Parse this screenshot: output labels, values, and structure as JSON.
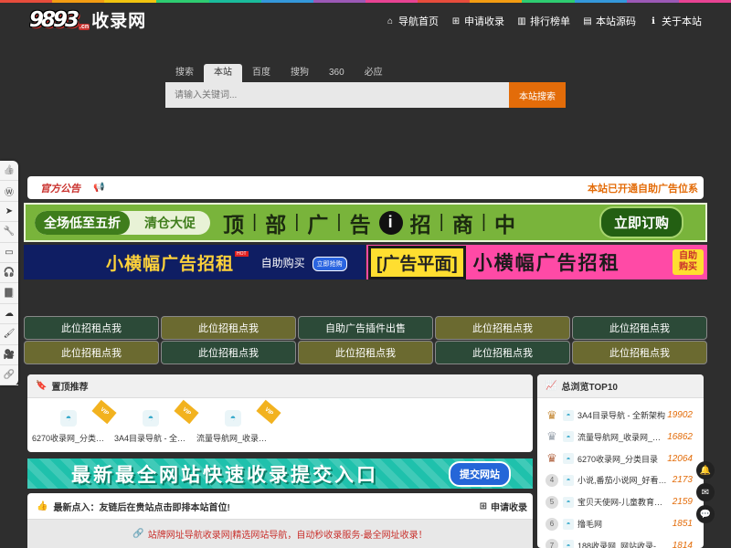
{
  "colors": {
    "accent": "#e36c09",
    "danger": "#c9302c",
    "background": "#2e2e2e",
    "rent_green": "#2c4a38",
    "rent_olive": "#6b6a30"
  },
  "top_stripe_colors": [
    "#e74c3c",
    "#f39c12",
    "#f1c40f",
    "#2ecc71",
    "#1abc9c",
    "#3498db",
    "#9b59b6",
    "#e84393",
    "#e74c3c",
    "#f39c12",
    "#2ecc71",
    "#3498db",
    "#9b59b6",
    "#e84393"
  ],
  "logo": {
    "number": "9893",
    "suffix": ".cn",
    "text": "收录网"
  },
  "topnav": [
    {
      "label": "导航首页",
      "icon": "home-icon",
      "glyph": "⌂"
    },
    {
      "label": "申请收录",
      "icon": "plus-square-icon",
      "glyph": "⊞"
    },
    {
      "label": "排行榜单",
      "icon": "bar-chart-icon",
      "glyph": "▥"
    },
    {
      "label": "本站源码",
      "icon": "book-icon",
      "glyph": "▤"
    },
    {
      "label": "关于本站",
      "icon": "info-circle-icon",
      "glyph": "ℹ"
    }
  ],
  "search": {
    "tabs": [
      "搜索",
      "本站",
      "百度",
      "搜狗",
      "360",
      "必应"
    ],
    "active_tab": "本站",
    "placeholder": "请输入关键词...",
    "value": "",
    "button": "本站搜索"
  },
  "sidebar_icons": [
    {
      "icon": "thumbs-up-icon",
      "glyph": "👍"
    },
    {
      "icon": "wordpress-icon",
      "glyph": "Ⓦ"
    },
    {
      "icon": "send-icon",
      "glyph": "➤"
    },
    {
      "icon": "wrench-icon",
      "glyph": "🔧"
    },
    {
      "icon": "hdd-icon",
      "glyph": "▭"
    },
    {
      "icon": "headphones-icon",
      "glyph": "🎧"
    },
    {
      "icon": "book-icon",
      "glyph": "📕"
    },
    {
      "icon": "cloud-icon",
      "glyph": "☁"
    },
    {
      "icon": "brush-icon",
      "glyph": "🖌"
    },
    {
      "icon": "video-icon",
      "glyph": "🎥"
    },
    {
      "icon": "link-icon",
      "glyph": "🔗"
    }
  ],
  "notice": {
    "title": "官方公告",
    "message": "本站已开通自助广告位系"
  },
  "ads": {
    "banner1": {
      "pill_a": "全场低至五折",
      "pill_b": "清仓大促",
      "chars": [
        "顶",
        "部",
        "广",
        "告",
        "招",
        "商",
        "中"
      ],
      "button": "立即订购"
    },
    "banner2": {
      "text": "小横幅广告招租",
      "hot": "HOT",
      "sub": "自助购买",
      "button": "立即抢购"
    },
    "banner3": {
      "box": "[广告平面]",
      "text": "小横幅广告招租",
      "badge": "自助购买"
    }
  },
  "rent_rows": [
    [
      "此位招租点我",
      "此位招租点我",
      "自助广告插件出售",
      "此位招租点我",
      "此位招租点我"
    ],
    [
      "此位招租点我",
      "此位招租点我",
      "此位招租点我",
      "此位招租点我",
      "此位招租点我"
    ]
  ],
  "pinned": {
    "title": "置顶推荐",
    "sites": [
      {
        "name": "6270收录网_分类目录",
        "vip": "VIP"
      },
      {
        "name": "3A4目录导航 - 全新架构",
        "vip": "VIP"
      },
      {
        "name": "流量导航网_收录网站",
        "vip": "VIP"
      }
    ]
  },
  "submit_ad": {
    "text": "最新最全网站快速收录提交入口",
    "button": "提交网站"
  },
  "latest": {
    "title": "最新点入：友链后在贵站点击即排本站首位!",
    "apply": "申请收录",
    "banner": "站牌网址导航收录网|精选网站导航，自动秒收录服务-最全网址收录！"
  },
  "top10": {
    "title": "总浏览TOP10",
    "items": [
      {
        "rank": "1",
        "name": "3A4目录导航 - 全新架构",
        "count": "19902"
      },
      {
        "rank": "2",
        "name": "流量导航网_收录网_免费收录",
        "count": "16862"
      },
      {
        "rank": "3",
        "name": "6270收录网_分类目录",
        "count": "12064"
      },
      {
        "rank": "4",
        "name": "小说,番茄小说网_好看的小说",
        "count": "2173"
      },
      {
        "rank": "5",
        "name": "宝贝天使网-儿童教育资讯",
        "count": "2159"
      },
      {
        "rank": "6",
        "name": "撸毛网",
        "count": "1851"
      },
      {
        "rank": "7",
        "name": "188收录网_网站收录-友情链接",
        "count": "1814"
      }
    ]
  },
  "float_buttons": [
    {
      "icon": "bell-icon",
      "glyph": "🔔"
    },
    {
      "icon": "envelope-icon",
      "glyph": "✉"
    },
    {
      "icon": "wechat-icon",
      "glyph": "💬"
    }
  ]
}
